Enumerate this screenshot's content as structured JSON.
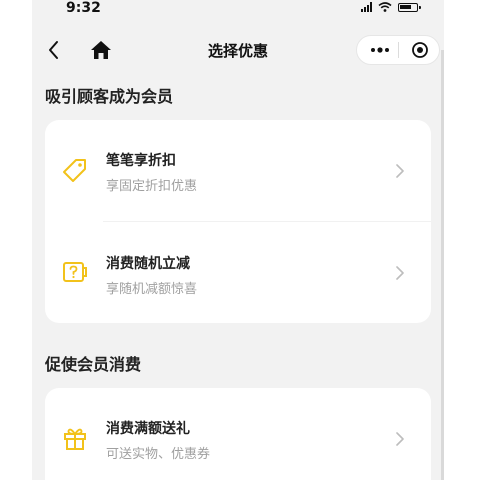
{
  "status_bar": {
    "time": "9:32"
  },
  "nav": {
    "title": "选择优惠"
  },
  "sections": [
    {
      "title": "吸引顾客成为会员",
      "items": [
        {
          "title": "笔笔享折扣",
          "desc": "享固定折扣优惠",
          "icon": "tag-icon"
        },
        {
          "title": "消费随机立减",
          "desc": "享随机减额惊喜",
          "icon": "mystery-discount-icon"
        }
      ]
    },
    {
      "title": "促使会员消费",
      "items": [
        {
          "title": "消费满额送礼",
          "desc": "可送实物、优惠券",
          "icon": "gift-icon"
        }
      ]
    }
  ],
  "colors": {
    "accent": "#f2c21b",
    "background": "#f2f2f2",
    "card": "#ffffff",
    "secondary_text": "#a0a0a0"
  }
}
